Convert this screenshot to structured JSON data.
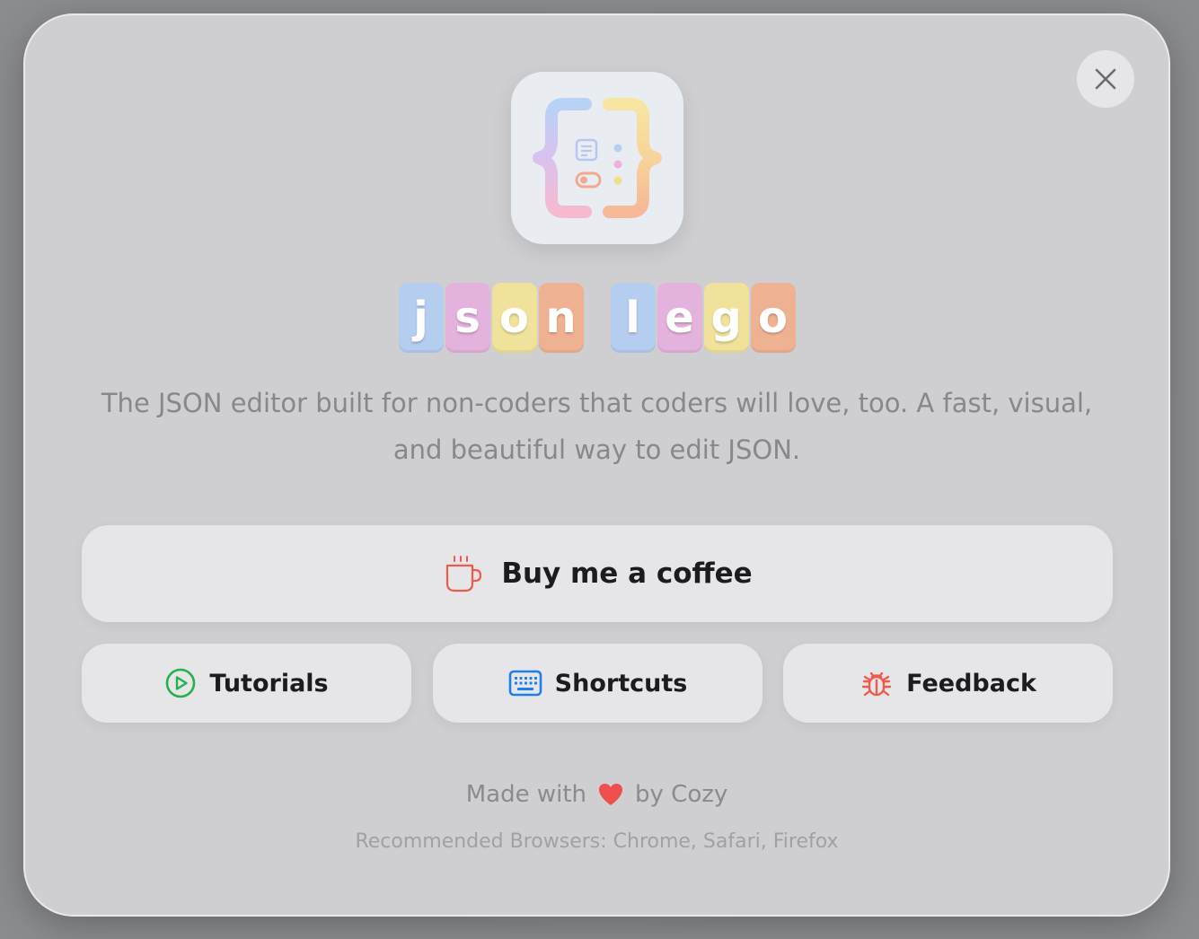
{
  "dialog": {
    "close_label": "Close"
  },
  "app": {
    "icon_name": "json-braces-app-icon",
    "logo_word_1": [
      "j",
      "s",
      "o",
      "n"
    ],
    "logo_word_2": [
      "l",
      "e",
      "g",
      "o"
    ],
    "tagline": "The JSON editor built for non-coders that coders will love, too. A fast, visual, and beautiful way to edit JSON."
  },
  "actions": {
    "coffee": {
      "label": "Buy me a coffee",
      "icon": "coffee-cup-icon",
      "icon_color": "#f15a4a"
    },
    "tutorials": {
      "label": "Tutorials",
      "icon": "play-circle-icon",
      "icon_color": "#22b24c"
    },
    "shortcuts": {
      "label": "Shortcuts",
      "icon": "keyboard-icon",
      "icon_color": "#1a7ff0"
    },
    "feedback": {
      "label": "Feedback",
      "icon": "bug-icon",
      "icon_color": "#f15a4a"
    }
  },
  "footer": {
    "made_with_prefix": "Made with",
    "made_with_suffix": "by Cozy",
    "heart_color": "#f04f4f",
    "browsers": "Recommended Browsers: Chrome, Safari, Firefox"
  },
  "colors": {
    "tile_blue": "#b5cdee",
    "tile_pink": "#e3b2dd",
    "tile_yellow": "#f0e29a",
    "tile_orange": "#eeb293"
  }
}
